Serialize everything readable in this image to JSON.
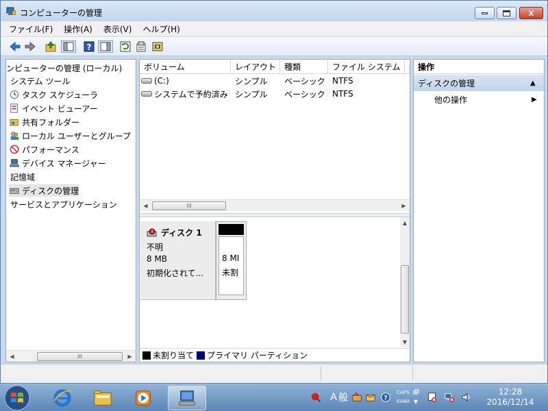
{
  "window": {
    "title": "コンピューターの管理",
    "min_glyph": "",
    "close_glyph": "x"
  },
  "menu": [
    "ファイル(F)",
    "操作(A)",
    "表示(V)",
    "ヘルプ(H)"
  ],
  "toolbar_icons": [
    "back-arrow-icon",
    "forward-arrow-icon",
    "up-folder-icon",
    "show-hide-tree-icon",
    "help-icon",
    "show-hide-action-pane-icon",
    "refresh-icon",
    "properties-icon",
    "disk-settings-icon"
  ],
  "tree": {
    "items": [
      {
        "label": "ンピューターの管理 (ローカル)",
        "icon": ""
      },
      {
        "label": "システム ツール",
        "icon": ""
      },
      {
        "label": "タスク スケジューラ",
        "icon": "clock-icon"
      },
      {
        "label": "イベント ビューアー",
        "icon": "event-viewer-icon"
      },
      {
        "label": "共有フォルダー",
        "icon": "shared-folder-icon"
      },
      {
        "label": "ローカル ユーザーとグループ",
        "icon": "users-icon"
      },
      {
        "label": "パフォーマンス",
        "icon": "performance-icon"
      },
      {
        "label": "デバイス マネージャー",
        "icon": "device-manager-icon"
      },
      {
        "label": "記憶域",
        "icon": ""
      },
      {
        "label": "ディスクの管理",
        "icon": "disk-management-icon"
      },
      {
        "label": "サービスとアプリケーション",
        "icon": ""
      }
    ],
    "scroll_thumb": "III"
  },
  "volumes": {
    "columns": [
      "ボリューム",
      "レイアウト",
      "種類",
      "ファイル システム",
      "状"
    ],
    "rows": [
      {
        "name": "(C:)",
        "layout": "シンプル",
        "type": "ベーシック",
        "fs": "NTFS"
      },
      {
        "name": "システムで予約済み",
        "layout": "シンプル",
        "type": "ベーシック",
        "fs": "NTFS"
      }
    ],
    "scroll_thumb": "III"
  },
  "disk": {
    "name": "ディスク 1",
    "status": "不明",
    "size": "8 MB",
    "state": "初期化されて...",
    "partition_size": "8 MI",
    "partition_state": "未割"
  },
  "legend": {
    "unallocated": "未割り当て",
    "primary": "プライマリ パーティション",
    "unallocated_color": "#000000",
    "primary_color": "#000080"
  },
  "actions": {
    "header": "操作",
    "section": "ディスクの管理",
    "section_arrow": "▲",
    "more": "他の操作",
    "more_arrow": "▶"
  },
  "taskbar": {
    "ime_mode": "A",
    "ime_kanji": "般",
    "caps": "CAPS",
    "kana": "KANA",
    "time": "12:28",
    "date": "2016/12/14"
  }
}
